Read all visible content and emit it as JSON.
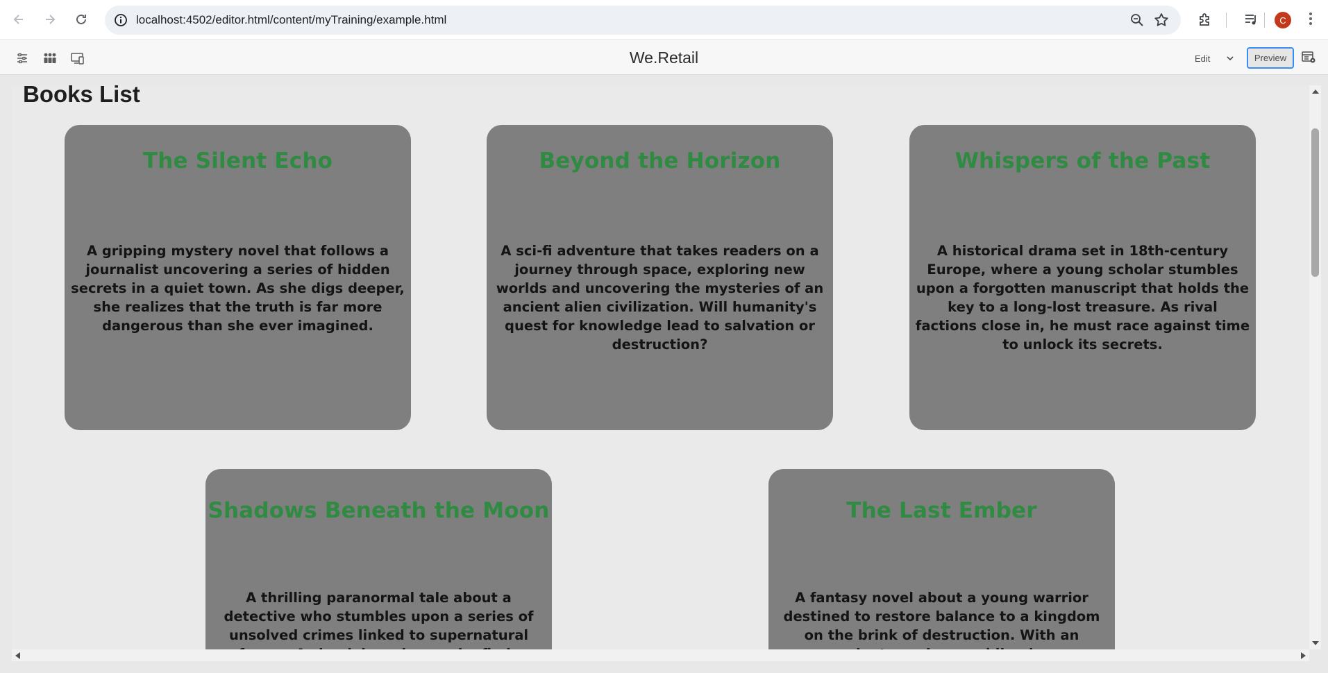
{
  "browser": {
    "url": "localhost:4502/editor.html/content/myTraining/example.html",
    "profile_initial": "C",
    "icons": [
      "back-icon",
      "forward-icon",
      "reload-icon",
      "site-info-icon",
      "zoom-icon",
      "bookmark-star-icon",
      "extensions-icon",
      "media-controls-icon",
      "profile-avatar",
      "more-menu-icon"
    ]
  },
  "editor": {
    "site_title": "We.Retail",
    "mode_label": "Edit",
    "preview_label": "Preview",
    "icons": [
      "page-properties-icon",
      "annotations-icon",
      "emulator-icon",
      "side-panel-icon"
    ]
  },
  "page": {
    "heading": "Books List",
    "books": [
      {
        "title": "The Silent Echo",
        "description": "A gripping mystery novel that follows a journalist uncovering a series of hidden secrets in a quiet town. As she digs deeper, she realizes that the truth is far more dangerous than she ever imagined."
      },
      {
        "title": "Beyond the Horizon",
        "description": "A sci-fi adventure that takes readers on a journey through space, exploring new worlds and uncovering the mysteries of an ancient alien civilization. Will humanity's quest for knowledge lead to salvation or destruction?"
      },
      {
        "title": "Whispers of the Past",
        "description": "A historical drama set in 18th-century Europe, where a young scholar stumbles upon a forgotten manuscript that holds the key to a long-lost treasure. As rival factions close in, he must race against time to unlock its secrets."
      },
      {
        "title": "Shadows Beneath the Moon",
        "description": "A thrilling paranormal tale about a detective who stumbles upon a series of unsolved crimes linked to supernatural forces. As he delves deeper, he finds"
      },
      {
        "title": "The Last Ember",
        "description": "A fantasy novel about a young warrior destined to restore balance to a kingdom on the brink of destruction. With an ancient prophecy guiding her"
      }
    ]
  },
  "colors": {
    "card_background": "#7f7f7f",
    "title_green": "#2e8b41",
    "preview_border": "#378ef0",
    "avatar": "#c2391b"
  }
}
